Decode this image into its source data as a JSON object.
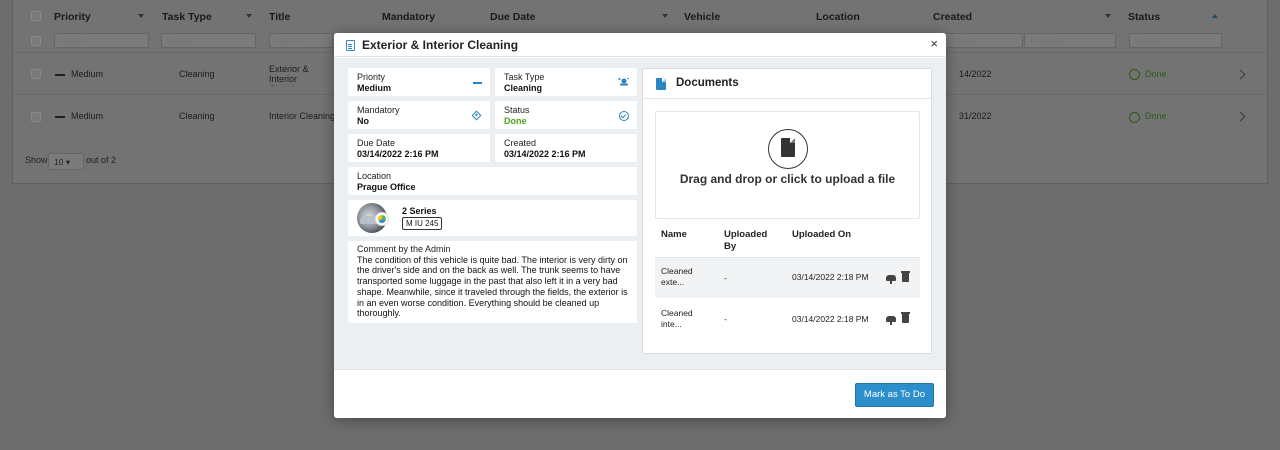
{
  "background": {
    "columns": {
      "priority": "Priority",
      "task_type": "Task Type",
      "title": "Title",
      "mandatory": "Mandatory",
      "due_date": "Due Date",
      "vehicle": "Vehicle",
      "location": "Location",
      "created": "Created",
      "status": "Status"
    },
    "filters": {
      "priority_placeholder": "Search...",
      "task_type_placeholder": "Search...",
      "title_placeholder": "Search...",
      "start_date": "Start Date",
      "end_date": "End Date",
      "status_placeholder": "Search..."
    },
    "rows": [
      {
        "priority": "Medium",
        "task_type": "Cleaning",
        "title": "Exterior & Interior Cleaning",
        "created": "03/14/2022",
        "status": "Done"
      },
      {
        "priority": "Medium",
        "task_type": "Cleaning",
        "title": "Interior Cleaning",
        "created": "03/31/2022",
        "status": "Done"
      }
    ],
    "pager": {
      "show_label": "Show",
      "page_size": "10",
      "out_of": "out of 2"
    }
  },
  "modal": {
    "title": "Exterior & Interior Cleaning",
    "close_glyph": "×",
    "fields": {
      "priority": {
        "label": "Priority",
        "value": "Medium"
      },
      "task_type": {
        "label": "Task Type",
        "value": "Cleaning"
      },
      "mandatory": {
        "label": "Mandatory",
        "value": "No"
      },
      "status": {
        "label": "Status",
        "value": "Done",
        "color": "#4ca617"
      },
      "due_date": {
        "label": "Due Date",
        "value": "03/14/2022 2:16 PM"
      },
      "created": {
        "label": "Created",
        "value": "03/14/2022 2:16 PM"
      },
      "location": {
        "label": "Location",
        "value": "Prague Office"
      }
    },
    "vehicle": {
      "name": "2 Series",
      "plate": "M IU 245"
    },
    "comment": {
      "heading": "Comment by the Admin",
      "text": "The condition of this vehicle is quite bad. The interior is very dirty on the driver's side and on the back as well. The trunk seems to have transported some luggage in the past that also left it in a very bad shape. Meanwhile, since it traveled through the fields, the exterior is in an even worse condition. Everything should be cleaned up thoroughly."
    },
    "documents": {
      "title": "Documents",
      "drop_text": "Drag and drop or click to upload a file",
      "columns": {
        "name": "Name",
        "uploaded_by": "Uploaded By",
        "uploaded_on": "Uploaded On"
      },
      "files": [
        {
          "name": "Cleaned exte...",
          "uploaded_by": "-",
          "uploaded_on": "03/14/2022 2:18 PM"
        },
        {
          "name": "Cleaned inte...",
          "uploaded_by": "-",
          "uploaded_on": "03/14/2022 2:18 PM"
        }
      ]
    },
    "primary_button": "Mark as To Do"
  },
  "colors": {
    "accent": "#2c8fcc",
    "done_green": "#4ca617",
    "icon_blue": "#2b84c4"
  },
  "icons": [
    "document-icon",
    "close-icon",
    "dash-icon",
    "cleaning-icon",
    "diamond-icon",
    "check-circle-icon",
    "file-icon",
    "cloud-upload-icon",
    "trash-icon"
  ]
}
